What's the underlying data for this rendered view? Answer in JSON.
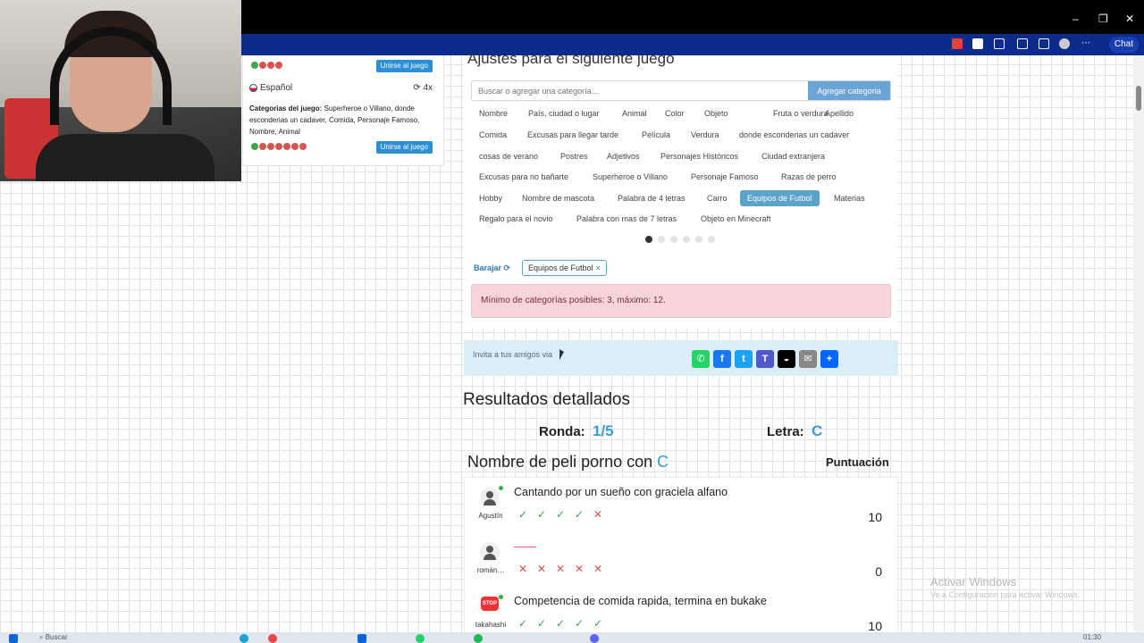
{
  "webcam": {
    "label": "webcam"
  },
  "browser": {
    "chat_label": "Chat"
  },
  "game_card": {
    "join_label": "Unirse al juego",
    "language": "Español",
    "rounds": "4x",
    "categories_label": "Categorias del juego:",
    "categories_text": "Superheroe o Villano, donde esconderias un cadaver, Comida, Personaje Famoso, Nombre, Animal"
  },
  "settings": {
    "title": "Ajustes para el siguiente juego",
    "search_placeholder": "Buscar o agregar una categoría...",
    "add_button": "Agregar categoria",
    "categories": [
      "Nombre",
      "País, ciudad o lugar",
      "Animal",
      "Color",
      "Objeto",
      "Fruta o verdura",
      "Apellido",
      "Comida",
      "Excusas para llegar tarde",
      "Película",
      "Verdura",
      "donde esconderias un cadaver",
      "cosas de verano",
      "Postres",
      "Adjetivos",
      "Personajes Históricos",
      "Ciudad extranjera",
      "Excusas para no bañarte",
      "Superheroe o Villano",
      "Personaje Famoso",
      "Razas de perro",
      "Hobby",
      "Nombre de mascota",
      "Palabra de 4 letras",
      "Carro",
      "Equipos de Futbol",
      "Materias",
      "Regalo para el novio",
      "Palabra con mas de 7 letras",
      "Objeto en Minecraft"
    ],
    "selected_category": "Equipos de Futbol",
    "shuffle_label": "Barajar",
    "shuffle_icon": "refresh-icon",
    "chip_label": "Equipos de Futbol",
    "chip_remove": "×",
    "alert": "Mínimo de categorías posibles: 3, máximo: 12."
  },
  "invite": {
    "text": "Invita a tus amigos via",
    "share_icons": [
      "whatsapp-icon",
      "facebook-icon",
      "twitter-icon",
      "teams-icon",
      "snapchat-icon",
      "email-icon",
      "plus-icon"
    ],
    "share_colors": [
      "#25d366",
      "#1877f2",
      "#1da1f2",
      "#5059c9",
      "#000000",
      "#888888",
      "#0166ff"
    ]
  },
  "results": {
    "title": "Resultados detallados",
    "round_label": "Ronda:",
    "round_value": "1/5",
    "letter_label": "Letra:",
    "letter_value": "C",
    "question": "Nombre de peli porno con",
    "question_letter": "C",
    "score_header": "Puntuación",
    "rows": [
      {
        "user": "Agustín",
        "answer": "Cantando por un sueño con graciela alfano",
        "votes": [
          "ok",
          "ok",
          "ok",
          "ok",
          "no"
        ],
        "score": "10"
      },
      {
        "user": "román…",
        "answer": "——",
        "votes": [
          "no",
          "no",
          "no",
          "no",
          "no"
        ],
        "score": "0"
      },
      {
        "user": "takahashi",
        "answer": "Competencia de comida rapida, termina en bukake",
        "votes": [
          "ok",
          "ok",
          "ok",
          "ok",
          "ok"
        ],
        "score": "10"
      }
    ]
  },
  "windows": {
    "watermark_title": "Activar Windows",
    "watermark_sub": "Ve a Configuración para activar Windows."
  },
  "taskbar": {
    "search": "Buscar",
    "time": "01:30"
  }
}
